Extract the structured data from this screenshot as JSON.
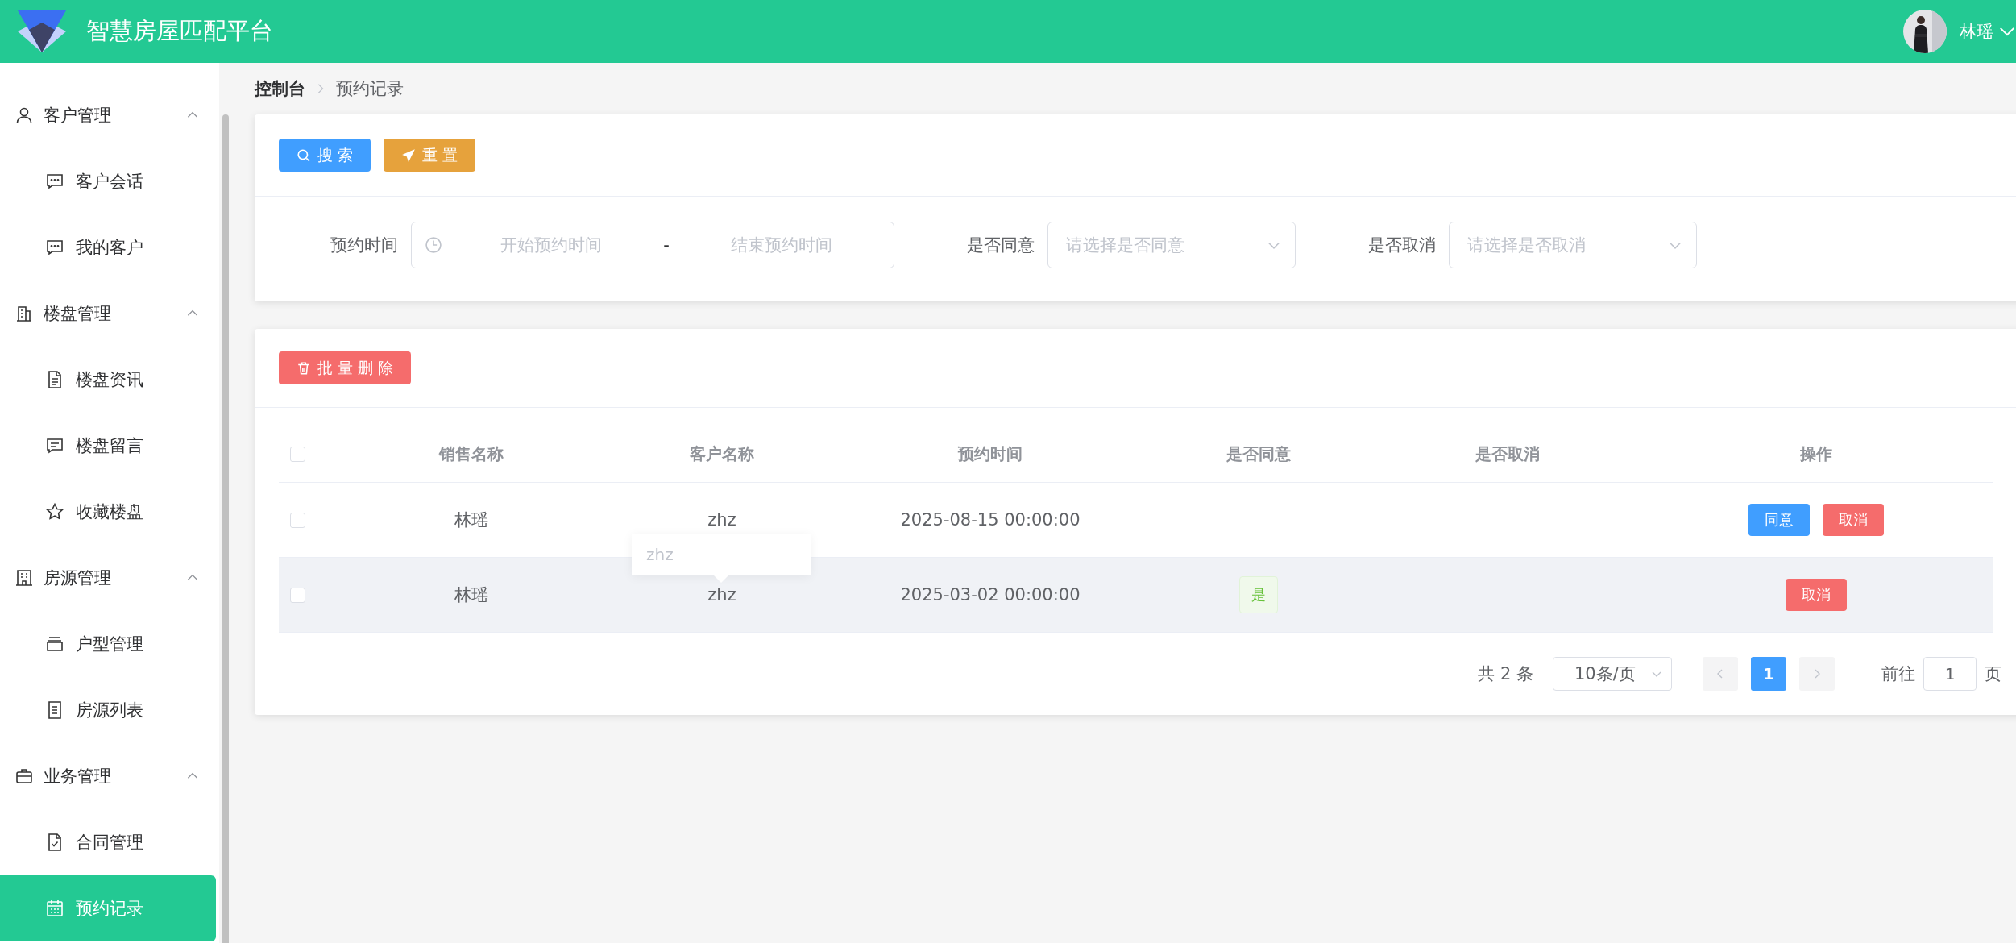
{
  "header": {
    "title": "智慧房屋匹配平台",
    "user": "林瑶"
  },
  "sidebar": {
    "groups": [
      {
        "label": "客户管理",
        "expanded": true,
        "children": [
          {
            "label": "客户会话",
            "selected": false
          },
          {
            "label": "我的客户",
            "selected": false
          }
        ]
      },
      {
        "label": "楼盘管理",
        "expanded": true,
        "children": [
          {
            "label": "楼盘资讯",
            "selected": false
          },
          {
            "label": "楼盘留言",
            "selected": false
          },
          {
            "label": "收藏楼盘",
            "selected": false
          }
        ]
      },
      {
        "label": "房源管理",
        "expanded": true,
        "children": [
          {
            "label": "户型管理",
            "selected": false
          },
          {
            "label": "房源列表",
            "selected": false
          }
        ]
      },
      {
        "label": "业务管理",
        "expanded": true,
        "children": [
          {
            "label": "合同管理",
            "selected": false
          },
          {
            "label": "预约记录",
            "selected": true
          }
        ]
      }
    ]
  },
  "breadcrumb": [
    "控制台",
    "预约记录"
  ],
  "search_buttons": [
    {
      "label": "搜 索",
      "kind": "search"
    },
    {
      "label": "重 置",
      "kind": "reset"
    }
  ],
  "filters": [
    {
      "kind": "daterange",
      "label": "预约时间",
      "start_placeholder": "开始预约时间",
      "separator": "-",
      "end_placeholder": "结束预约时间"
    },
    {
      "kind": "select",
      "label": "是否同意",
      "placeholder": "请选择是否同意"
    },
    {
      "kind": "select",
      "label": "是否取消",
      "placeholder": "请选择是否取消"
    }
  ],
  "batch_delete": "批 量 删 除",
  "table": {
    "header_checked": false,
    "columns": [
      "销售名称",
      "客户名称",
      "预约时间",
      "是否同意",
      "是否取消",
      "操作"
    ],
    "rows": [
      {
        "checked": false,
        "highlighted": false,
        "sales": "林瑶",
        "customer": "zhz",
        "time": "2025-08-15 00:00:00",
        "actions": [
          {
            "label": "同意",
            "kind": "agree"
          },
          {
            "label": "取消",
            "kind": "cancel"
          }
        ]
      },
      {
        "checked": false,
        "highlighted": true,
        "sales": "林瑶",
        "customer": "zhz",
        "time": "2025-03-02 00:00:00",
        "agreed": "是",
        "actions": [
          {
            "label": "取消",
            "kind": "cancel"
          }
        ]
      }
    ],
    "tooltips": [
      {
        "text": "zhz",
        "kind": "arrow"
      }
    ]
  },
  "pagination": {
    "total": "共 2 条",
    "page_size": "10条/页",
    "pages": [
      {
        "label": "1",
        "selected": true
      }
    ],
    "goto_label": "前往",
    "goto_value": "1",
    "goto_suffix": "页"
  }
}
